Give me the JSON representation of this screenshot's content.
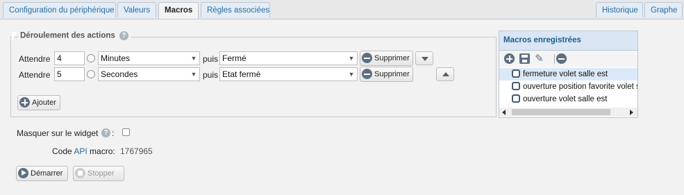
{
  "tabs_left": [
    "Configuration du périphérique",
    "Valeurs",
    "Macros",
    "Règles associées"
  ],
  "tabs_right": [
    "Historique",
    "Graphe"
  ],
  "active_tab": "Macros",
  "actions": {
    "legend": "Déroulement des actions",
    "rows": [
      {
        "label": "Attendre",
        "value": "4",
        "unit": "Minutes",
        "then": "puis",
        "target": "Fermé",
        "delete": "Supprimer",
        "move": "down"
      },
      {
        "label": "Attendre",
        "value": "5",
        "unit": "Secondes",
        "then": "puis",
        "target": "Etat fermé",
        "delete": "Supprimer",
        "move": "up"
      }
    ],
    "add_label": "Ajouter"
  },
  "widget": {
    "hide_label": "Masquer sur le widget",
    "colon": ":"
  },
  "api": {
    "label_prefix": "Code",
    "label_api": "API",
    "label_suffix": "macro:",
    "value": "1767965"
  },
  "buttons": {
    "start": "Démarrer",
    "stop": "Stopper"
  },
  "macros_panel": {
    "title": "Macros enregistrées",
    "items": [
      {
        "label": "fermeture volet salle est",
        "selected": true
      },
      {
        "label": "ouverture position favorite volet sa",
        "selected": false
      },
      {
        "label": "ouverture volet salle est",
        "selected": false
      }
    ]
  },
  "icons": {
    "help": "help-icon",
    "remove": "minus-circle-icon",
    "add": "plus-circle-icon",
    "play": "play-circle-icon",
    "stop": "stop-circle-icon",
    "save": "save-icon",
    "edit": "pencil-icon"
  },
  "colors": {
    "accent": "#2b6d9f",
    "icon": "#5f6f80",
    "panel_header": "#dae6f3",
    "selected_row": "#dbe8f7"
  }
}
